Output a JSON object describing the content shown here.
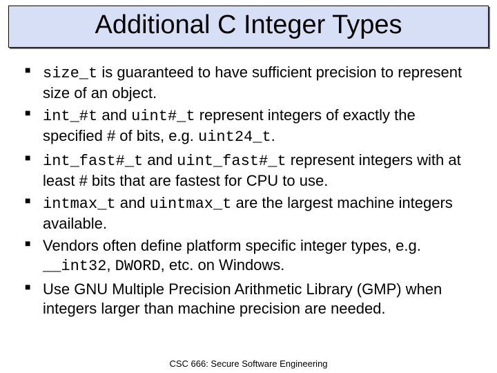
{
  "title": "Additional C Integer Types",
  "bullets": [
    {
      "segments": [
        {
          "t": "size_t",
          "code": true
        },
        {
          "t": " is guaranteed to have sufficient precision to represent size of an object."
        }
      ]
    },
    {
      "segments": [
        {
          "t": "int_#t",
          "code": true
        },
        {
          "t": " and "
        },
        {
          "t": "uint#_t",
          "code": true
        },
        {
          "t": " represent integers of exactly the specified # of bits, e.g. "
        },
        {
          "t": "uint24_t",
          "code": true
        },
        {
          "t": "."
        }
      ]
    },
    {
      "segments": [
        {
          "t": "int_fast#_t",
          "code": true
        },
        {
          "t": " and "
        },
        {
          "t": "uint_fast#_t",
          "code": true
        },
        {
          "t": " represent integers with at least # bits that are fastest for CPU to use."
        }
      ]
    },
    {
      "segments": [
        {
          "t": "intmax_t",
          "code": true
        },
        {
          "t": " and "
        },
        {
          "t": "uintmax_t",
          "code": true
        },
        {
          "t": " are the largest machine integers available."
        }
      ]
    },
    {
      "segments": [
        {
          "t": "Vendors often define platform specific integer types, e.g. "
        },
        {
          "t": "__int32",
          "code": true
        },
        {
          "t": ", "
        },
        {
          "t": "DWORD",
          "code": true
        },
        {
          "t": ", etc. on Windows."
        }
      ]
    },
    {
      "segments": [
        {
          "t": "Use GNU Multiple Precision Arithmetic Library (GMP) when integers larger than machine precision are needed."
        }
      ]
    }
  ],
  "footer": "CSC 666: Secure Software Engineering"
}
